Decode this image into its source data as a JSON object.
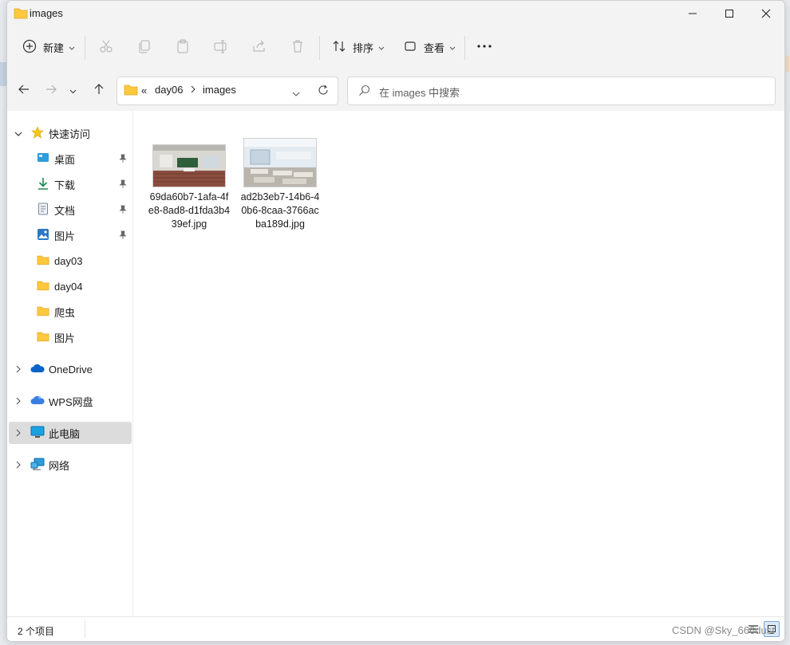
{
  "window": {
    "title": "images"
  },
  "toolbar": {
    "new_label": "新建",
    "sort_label": "排序",
    "view_label": "查看"
  },
  "address": {
    "overflow": "«",
    "crumbs": [
      "day06",
      "images"
    ]
  },
  "search": {
    "placeholder": "在 images 中搜索"
  },
  "nav": {
    "quick_access": "快速访问",
    "pinned": [
      {
        "label": "桌面",
        "icon": "desktop-icon"
      },
      {
        "label": "下载",
        "icon": "download-icon"
      },
      {
        "label": "文档",
        "icon": "document-icon"
      },
      {
        "label": "图片",
        "icon": "pictures-icon"
      }
    ],
    "folders": [
      "day03",
      "day04",
      "爬虫",
      "图片"
    ],
    "onedrive": "OneDrive",
    "wps": "WPS网盘",
    "this_pc": "此电脑",
    "network": "网络"
  },
  "files": [
    {
      "name": "69da60b7-1afa-4fe8-8ad8-d1fda3b439ef.jpg"
    },
    {
      "name": "ad2b3eb7-14b6-40b6-8caa-3766acba189d.jpg"
    }
  ],
  "status": {
    "count": "2 个项目"
  },
  "watermark": "CSDN @Sky_666dust",
  "colors": {
    "accent": "#0067c0",
    "folder": "#ffc83d",
    "selected": "#dcdcdc"
  }
}
